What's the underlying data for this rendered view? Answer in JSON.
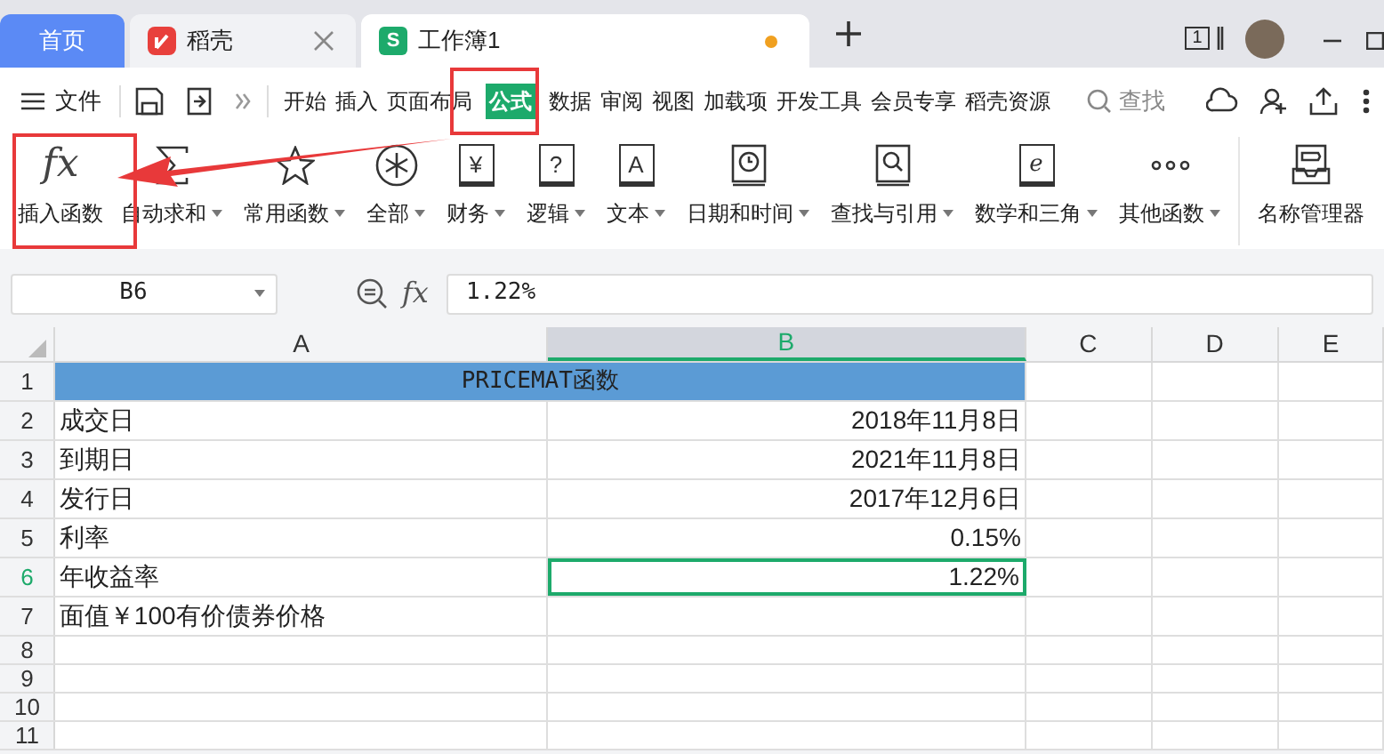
{
  "tabs": [
    {
      "kind": "home",
      "label": "首页",
      "selected": false
    },
    {
      "kind": "docer",
      "label": "稻壳",
      "selected": false
    },
    {
      "kind": "sheet",
      "label": "工作簿1",
      "logo_letter": "S",
      "selected": true,
      "unsaved": true
    }
  ],
  "window_count": "1",
  "menu": {
    "file": "文件",
    "items": [
      {
        "label": "开始",
        "selected": false
      },
      {
        "label": "插入",
        "selected": false
      },
      {
        "label": "页面布局",
        "selected": false
      },
      {
        "label": "公式",
        "selected": true
      },
      {
        "label": "数据",
        "selected": false
      },
      {
        "label": "审阅",
        "selected": false
      },
      {
        "label": "视图",
        "selected": false
      },
      {
        "label": "加载项",
        "selected": false
      },
      {
        "label": "开发工具",
        "selected": false
      },
      {
        "label": "会员专享",
        "selected": false
      },
      {
        "label": "稻壳资源",
        "selected": false
      }
    ],
    "search": {
      "placeholder": "查找"
    }
  },
  "ribbon": [
    {
      "kind": "glyph",
      "glyph": "fx",
      "label": "插入函数",
      "dropdown": false
    },
    {
      "kind": "sigma",
      "label": "自动求和",
      "dropdown": true
    },
    {
      "kind": "star",
      "label": "常用函数",
      "dropdown": true
    },
    {
      "kind": "asterisk",
      "label": "全部",
      "dropdown": true
    },
    {
      "kind": "book",
      "glyph": "¥",
      "label": "财务",
      "dropdown": true
    },
    {
      "kind": "book",
      "glyph": "?",
      "label": "逻辑",
      "dropdown": true
    },
    {
      "kind": "book",
      "glyph": "A",
      "label": "文本",
      "dropdown": true
    },
    {
      "kind": "clock",
      "label": "日期和时间",
      "dropdown": true
    },
    {
      "kind": "magnifier",
      "label": "查找与引用",
      "dropdown": true
    },
    {
      "kind": "book",
      "glyph": "e",
      "label": "数学和三角",
      "dropdown": true
    },
    {
      "kind": "dots",
      "label": "其他函数",
      "dropdown": true
    },
    {
      "kind": "tag",
      "label": "名称管理器",
      "dropdown": false
    }
  ],
  "formula_bar": {
    "name_box": "B6",
    "fx_label": "fx",
    "value": "1.22%"
  },
  "sheet": {
    "columns": [
      {
        "label": "A",
        "selected": false
      },
      {
        "label": "B",
        "selected": true
      },
      {
        "label": "C",
        "selected": false
      },
      {
        "label": "D",
        "selected": false
      },
      {
        "label": "E",
        "selected": false
      }
    ],
    "rows": [
      {
        "number": "1",
        "kind": "title",
        "title": "PRICEMAT函数",
        "selected": false
      },
      {
        "number": "2",
        "a": "成交日",
        "b": "2018年11月8日",
        "selected": false
      },
      {
        "number": "3",
        "a": "到期日",
        "b": "2021年11月8日",
        "selected": false
      },
      {
        "number": "4",
        "a": "发行日",
        "b": "2017年12月6日",
        "selected": false
      },
      {
        "number": "5",
        "a": "利率",
        "b": "0.15%",
        "selected": false
      },
      {
        "number": "6",
        "a": "年收益率",
        "b": "1.22%",
        "selected": true
      },
      {
        "number": "7",
        "a": "面值￥100有价债券价格",
        "selected": false
      },
      {
        "number": "8",
        "selected": false
      },
      {
        "number": "9",
        "selected": false
      },
      {
        "number": "10",
        "selected": false
      },
      {
        "number": "11",
        "selected": false
      }
    ]
  }
}
